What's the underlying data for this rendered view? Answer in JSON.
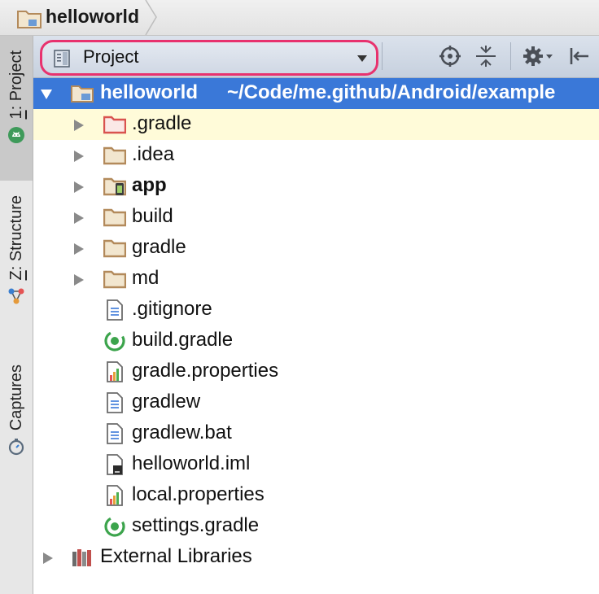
{
  "breadcrumb": {
    "label": "helloworld"
  },
  "stripe": {
    "tabs": [
      {
        "number": "1",
        "rest": ": Project"
      },
      {
        "number": "Z",
        "rest": ": Structure"
      },
      {
        "number": "",
        "rest": "Captures"
      }
    ]
  },
  "toolwindow": {
    "view_select": {
      "selected": "Project"
    }
  },
  "tree": {
    "root": {
      "label": "helloworld",
      "path": "~/Code/me.github/Android/example"
    },
    "items": [
      {
        "label": ".gradle",
        "icon": "folder-excluded-icon"
      },
      {
        "label": ".idea",
        "icon": "folder-icon"
      },
      {
        "label": "app",
        "icon": "android-module-icon"
      },
      {
        "label": "build",
        "icon": "folder-icon"
      },
      {
        "label": "gradle",
        "icon": "folder-icon"
      },
      {
        "label": "md",
        "icon": "folder-icon"
      },
      {
        "label": ".gitignore",
        "icon": "text-file-icon"
      },
      {
        "label": "build.gradle",
        "icon": "gradle-file-icon"
      },
      {
        "label": "gradle.properties",
        "icon": "properties-file-icon"
      },
      {
        "label": "gradlew",
        "icon": "text-file-icon"
      },
      {
        "label": "gradlew.bat",
        "icon": "text-file-icon"
      },
      {
        "label": "helloworld.iml",
        "icon": "iml-file-icon"
      },
      {
        "label": "local.properties",
        "icon": "properties-file-icon"
      },
      {
        "label": "settings.gradle",
        "icon": "gradle-file-icon"
      }
    ],
    "external": {
      "label": "External Libraries"
    }
  },
  "colors": {
    "selection": "#3a78d8",
    "hover_row": "#fffbd9",
    "highlight_ring": "#e8326e",
    "folder": "#b38a5b",
    "excluded_folder": "#d9534f"
  }
}
